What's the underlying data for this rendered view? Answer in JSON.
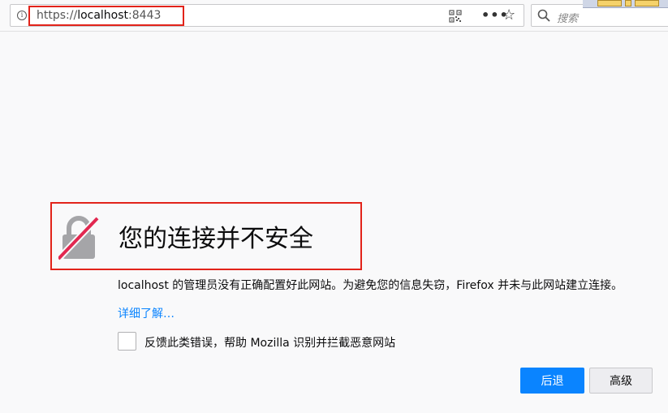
{
  "url": {
    "scheme": "https://",
    "host": "localhost",
    "port": ":8443"
  },
  "search": {
    "placeholder": "搜索"
  },
  "toolbar_icons": {
    "info": "info-icon",
    "qr": "qr-code-icon",
    "more": "more-icon",
    "bookmark": "star-icon",
    "search": "search-icon"
  },
  "error_page": {
    "title": "您的连接并不安全",
    "description": "localhost 的管理员没有正确配置好此网站。为避免您的信息失窃，Firefox 并未与此网站建立连接。",
    "learn_more": "详细了解…",
    "report_checkbox_label": "反馈此类错误，帮助 Mozilla 识别并拦截恶意网站",
    "report_checked": false,
    "go_back_button": "后退",
    "advanced_button": "高级"
  },
  "colors": {
    "primary_button": "#0a84ff",
    "link": "#0a84ff",
    "highlight_box": "#e2231a",
    "lock_grey": "#a5a5a8",
    "lock_slash": "#e22850"
  }
}
